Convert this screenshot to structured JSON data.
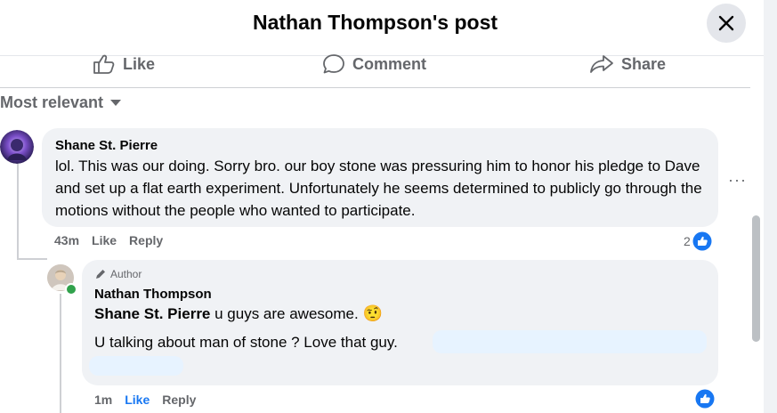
{
  "header": {
    "title": "Nathan Thompson's post",
    "close_icon": "close-icon"
  },
  "actions": {
    "like": "Like",
    "comment": "Comment",
    "share": "Share"
  },
  "sort": {
    "label": "Most relevant"
  },
  "comment": {
    "author": "Shane St. Pierre",
    "text": "lol. This was our doing. Sorry bro. our boy stone was pressuring him to honor his pledge to Dave and set up a flat earth experiment. Unfortunately he seems determined to publicly go through the motions without the people who wanted to participate.",
    "time": "43m",
    "like": "Like",
    "reply": "Reply",
    "reaction_count": "2",
    "more": "···"
  },
  "reply": {
    "badge": "Author",
    "author": "Nathan Thompson",
    "mention": "Shane St. Pierre",
    "text1": "u guys are awesome.",
    "emoji": "🤨",
    "text2": "U talking about man of stone ? Love that guy.",
    "time": "1m",
    "like": "Like",
    "reply": "Reply"
  },
  "colors": {
    "accent": "#1877f2",
    "text_secondary": "#65676b",
    "bubble": "#f0f2f5"
  }
}
